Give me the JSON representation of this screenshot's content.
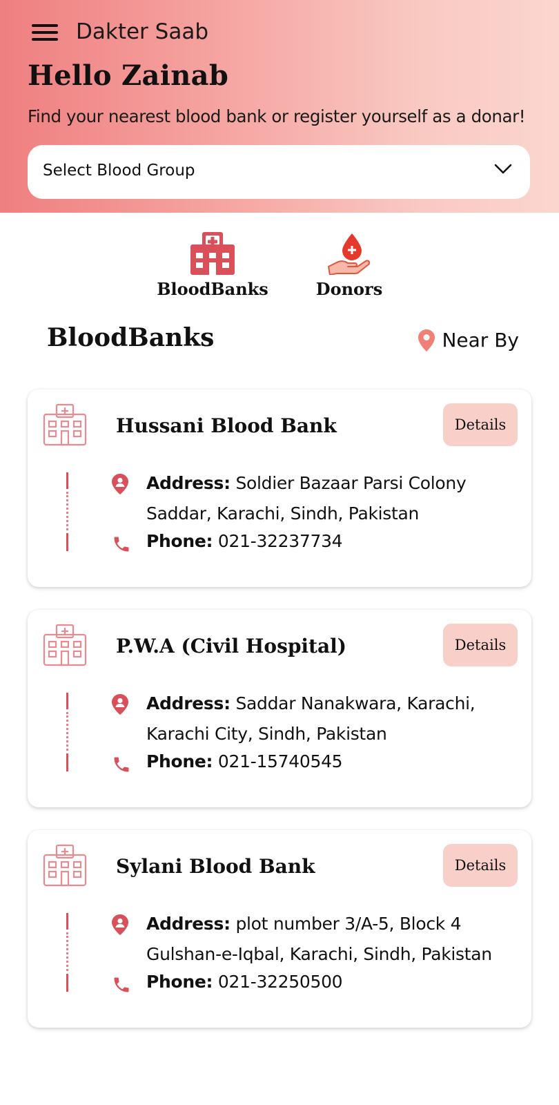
{
  "header": {
    "app_title": "Dakter Saab",
    "greeting": "Hello Zainab",
    "subtitle": "Find your nearest blood bank or register yourself as a donar!"
  },
  "blood_group_select": {
    "placeholder": "Select Blood Group"
  },
  "categories": [
    {
      "label": "BloodBanks",
      "icon": "hospital-icon"
    },
    {
      "label": "Donors",
      "icon": "blood-donation-icon"
    }
  ],
  "section": {
    "title": "BloodBanks",
    "nearby_label": "Near By"
  },
  "address_label": "Address:",
  "phone_label": "Phone:",
  "details_label": "Details",
  "banks": [
    {
      "name": "Hussani Blood Bank",
      "address": "Soldier Bazaar Parsi Colony Saddar, Karachi, Sindh, Pakistan",
      "phone": "021-32237734"
    },
    {
      "name": "P.W.A (Civil Hospital)",
      "address": "Saddar Nanakwara, Karachi, Karachi City, Sindh, Pakistan",
      "phone": "021-15740545"
    },
    {
      "name": "Sylani Blood Bank",
      "address": "plot number 3/A-5, Block 4 Gulshan-e-Iqbal, Karachi, Sindh, Pakistan",
      "phone": "021-32250500"
    }
  ],
  "colors": {
    "accent_red": "#d9505a",
    "details_bg": "#f8d0c9",
    "header_gradient_start": "#ef7f80",
    "header_gradient_end": "#fbd6cf"
  }
}
